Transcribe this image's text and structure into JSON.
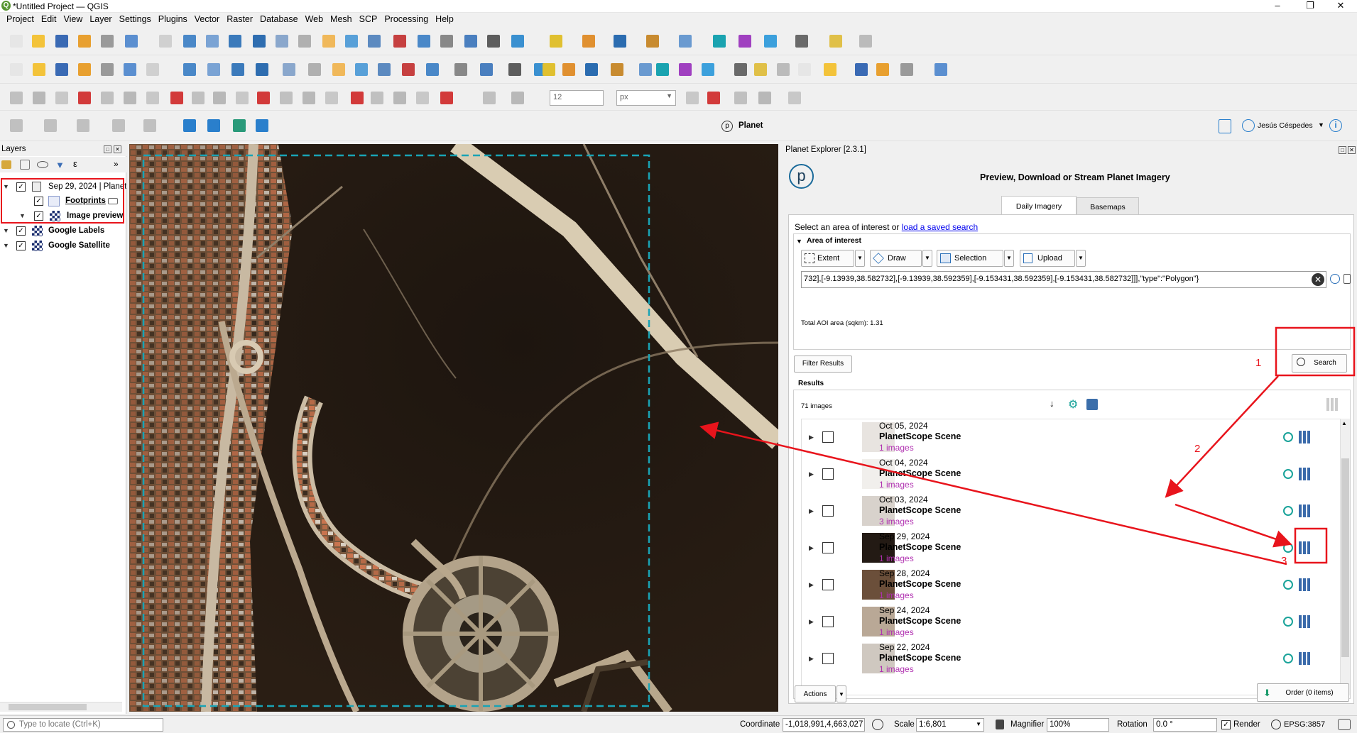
{
  "window": {
    "title": "*Untitled Project — QGIS",
    "app_icon": "Q"
  },
  "menu": [
    "Project",
    "Edit",
    "View",
    "Layer",
    "Settings",
    "Plugins",
    "Vector",
    "Raster",
    "Database",
    "Web",
    "Mesh",
    "SCP",
    "Processing",
    "Help"
  ],
  "toolbar4": {
    "snap_value": "12",
    "snap_unit": "px",
    "planet_label": "Planet",
    "user_name": "Jesús Céspedes"
  },
  "layers": {
    "title": "Layers",
    "items": [
      {
        "label": "Sep 29, 2024 | Planet"
      },
      {
        "label": "Footprints"
      },
      {
        "label": "Image preview"
      },
      {
        "label": "Google Labels"
      },
      {
        "label": "Google Satellite"
      }
    ]
  },
  "planet": {
    "panel_title": "Planet Explorer [2.3.1]",
    "logo": "p",
    "heading": "Preview, Download or Stream Planet Imagery",
    "tabs": [
      "Daily Imagery",
      "Basemaps"
    ],
    "aoi_prompt": "Select an area of interest or ",
    "aoi_link": "load a saved search",
    "aoi_section": "Area of interest",
    "aoi_buttons": [
      "Extent",
      "Draw",
      "Selection",
      "Upload"
    ],
    "aoi_value": "732],[-9.13939,38.582732],[-9.13939,38.592359],[-9.153431,38.592359],[-9.153431,38.582732]]],\"type\":\"Polygon\"}",
    "aoi_area_label": "Total AOI area (sqkm):",
    "aoi_area_value": "1.31",
    "filter_button": "Filter Results",
    "search_button": "Search",
    "results_label": "Results",
    "results_count": "71 images",
    "results": [
      {
        "date": "Oct 05, 2024",
        "name": "PlanetScope Scene",
        "count": "1 images"
      },
      {
        "date": "Oct 04, 2024",
        "name": "PlanetScope Scene",
        "count": "1 images"
      },
      {
        "date": "Oct 03, 2024",
        "name": "PlanetScope Scene",
        "count": "3 images"
      },
      {
        "date": "Sep 29, 2024",
        "name": "PlanetScope Scene",
        "count": "1 images"
      },
      {
        "date": "Sep 28, 2024",
        "name": "PlanetScope Scene",
        "count": "1 images"
      },
      {
        "date": "Sep 24, 2024",
        "name": "PlanetScope Scene",
        "count": "1 images"
      },
      {
        "date": "Sep 22, 2024",
        "name": "PlanetScope Scene",
        "count": "1 images"
      }
    ],
    "actions_button": "Actions",
    "order_button": "Order (0 items)"
  },
  "annotations": {
    "step1": "1",
    "step2": "2",
    "step3": "3",
    "color": "#e8141c"
  },
  "status": {
    "locate_placeholder": "Type to locate (Ctrl+K)",
    "coordinate_label": "Coordinate",
    "coordinate_value": "-1,018,991,4,663,027",
    "scale_label": "Scale",
    "scale_value": "1:6,801",
    "magnifier_label": "Magnifier",
    "magnifier_value": "100%",
    "rotation_label": "Rotation",
    "rotation_value": "0.0 °",
    "render_label": "Render",
    "crs": "EPSG:3857"
  }
}
